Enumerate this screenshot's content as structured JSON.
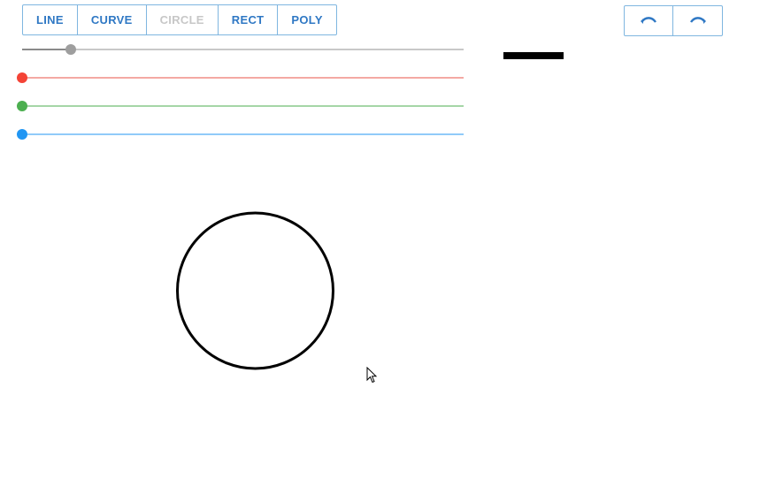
{
  "tools": [
    {
      "label": "LINE",
      "name": "tool-line-button",
      "enabled": true
    },
    {
      "label": "CURVE",
      "name": "tool-curve-button",
      "enabled": true
    },
    {
      "label": "CIRCLE",
      "name": "tool-circle-button",
      "enabled": false
    },
    {
      "label": "RECT",
      "name": "tool-rect-button",
      "enabled": true
    },
    {
      "label": "POLY",
      "name": "tool-poly-button",
      "enabled": true
    }
  ],
  "history": {
    "undo_icon": "undo-icon",
    "redo_icon": "redo-icon",
    "icon_color": "#2f78c4"
  },
  "sliders": [
    {
      "name": "stroke-width-slider",
      "value": 0.11,
      "track_color": "#c8c8c8",
      "fill_color": "#8a8a8a",
      "thumb_color": "#9e9e9e"
    },
    {
      "name": "red-channel-slider",
      "value": 0.0,
      "track_color": "#f4a9a3",
      "fill_color": "#f4a9a3",
      "thumb_color": "#f44336"
    },
    {
      "name": "green-channel-slider",
      "value": 0.0,
      "track_color": "#a5d6a7",
      "fill_color": "#a5d6a7",
      "thumb_color": "#4caf50"
    },
    {
      "name": "blue-channel-slider",
      "value": 0.0,
      "track_color": "#90caf9",
      "fill_color": "#90caf9",
      "thumb_color": "#2196f3"
    }
  ],
  "stroke_preview_color": "#000000",
  "drawn_shape": {
    "type": "circle",
    "stroke_color": "#000000"
  }
}
